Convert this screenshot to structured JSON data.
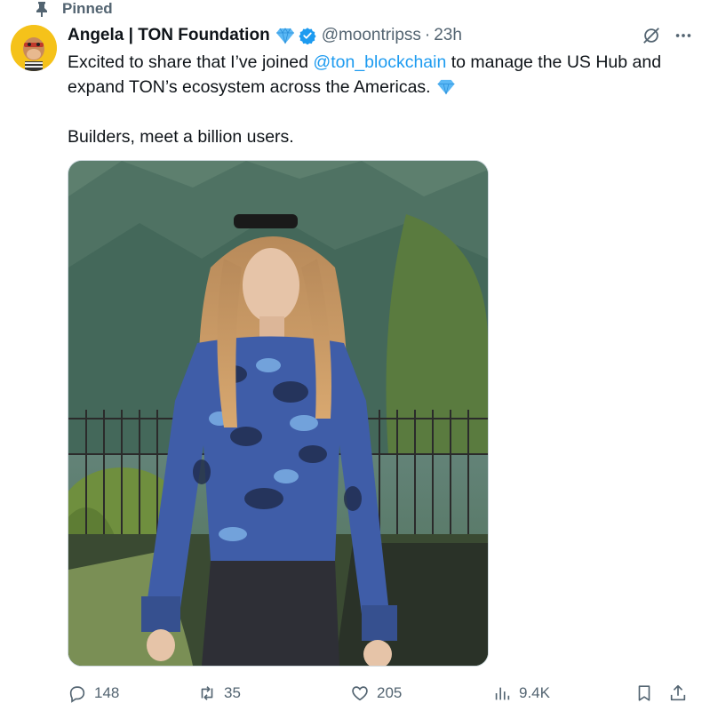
{
  "pinned": {
    "label": "Pinned",
    "icon": "pin-icon"
  },
  "author": {
    "display_name": "Angela | TON Foundation",
    "handle": "@moontripss",
    "timestamp": "23h",
    "avatar": "bored-ape-avatar",
    "verified_color": "#1d9bf0"
  },
  "tweet": {
    "line1_before": "Excited to share that I’ve joined ",
    "mention": "@ton_blockchain",
    "line1_after": " to manage the US Hub and expand TON’s ecosystem across the Americas.",
    "paragraph2": "Builders, meet a billion users.",
    "media": "photo-woman-blue-sweater"
  },
  "actions": {
    "replies": "148",
    "reposts": "35",
    "likes": "205",
    "views": "9.4K"
  },
  "colors": {
    "accent": "#1d9bf0",
    "muted": "#536471",
    "text": "#0f1419"
  }
}
